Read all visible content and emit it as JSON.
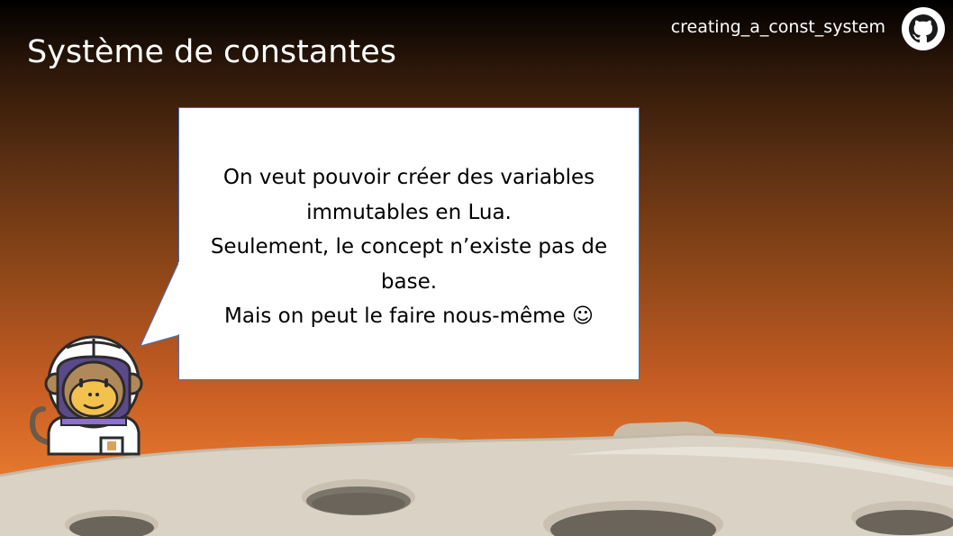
{
  "slide": {
    "title": "Système de constantes",
    "repo_name": "creating_a_const_system",
    "repo_icon": "github-icon",
    "bubble_lines": [
      "On veut pouvoir créer des variables",
      "immutables en Lua.",
      "Seulement, le concept n’existe pas de",
      "base.",
      "Mais on peut le faire nous-même ☺"
    ],
    "character": "astronaut-monkey-icon",
    "colors": {
      "background_top": "#000000",
      "background_bottom": "#ef7f30",
      "bubble_border": "#4472c4",
      "moon_surface": "#d9d2c5"
    }
  }
}
